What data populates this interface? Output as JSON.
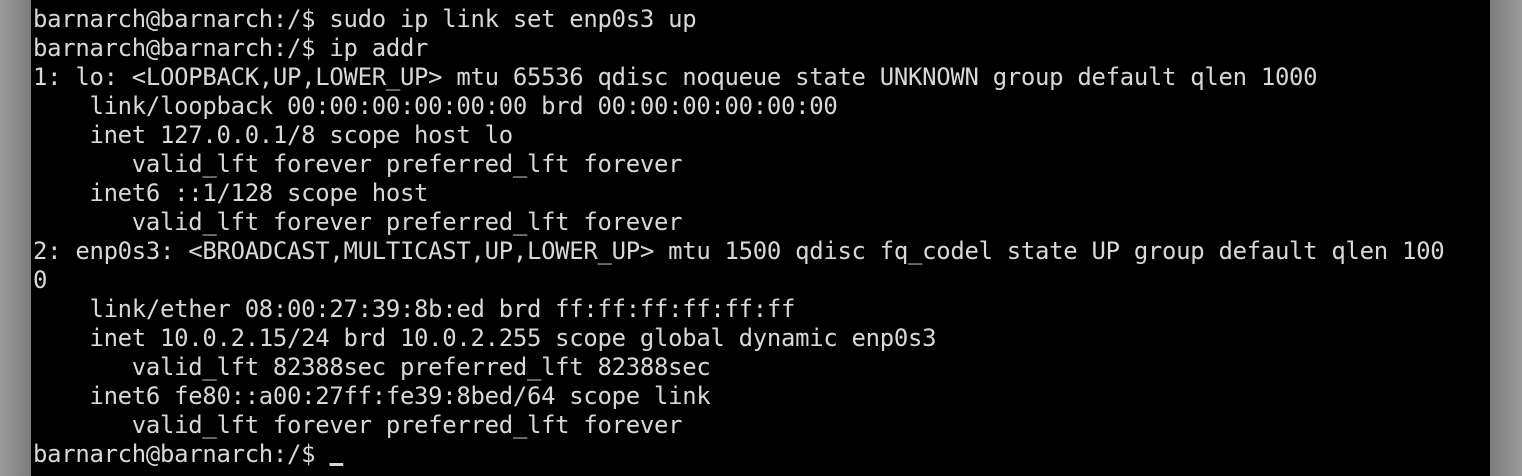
{
  "terminal": {
    "lines": [
      "barnarch@barnarch:/$ sudo ip link set enp0s3 up",
      "barnarch@barnarch:/$ ip addr",
      "1: lo: <LOOPBACK,UP,LOWER_UP> mtu 65536 qdisc noqueue state UNKNOWN group default qlen 1000",
      "    link/loopback 00:00:00:00:00:00 brd 00:00:00:00:00:00",
      "    inet 127.0.0.1/8 scope host lo",
      "       valid_lft forever preferred_lft forever",
      "    inet6 ::1/128 scope host",
      "       valid_lft forever preferred_lft forever",
      "2: enp0s3: <BROADCAST,MULTICAST,UP,LOWER_UP> mtu 1500 qdisc fq_codel state UP group default qlen 100",
      "0",
      "    link/ether 08:00:27:39:8b:ed brd ff:ff:ff:ff:ff:ff",
      "    inet 10.0.2.15/24 brd 10.0.2.255 scope global dynamic enp0s3",
      "       valid_lft 82388sec preferred_lft 82388sec",
      "    inet6 fe80::a00:27ff:fe39:8bed/64 scope link",
      "       valid_lft forever preferred_lft forever"
    ],
    "prompt": "barnarch@barnarch:/$ ",
    "colors": {
      "background": "#000000",
      "foreground": "#d8d8d8"
    }
  }
}
